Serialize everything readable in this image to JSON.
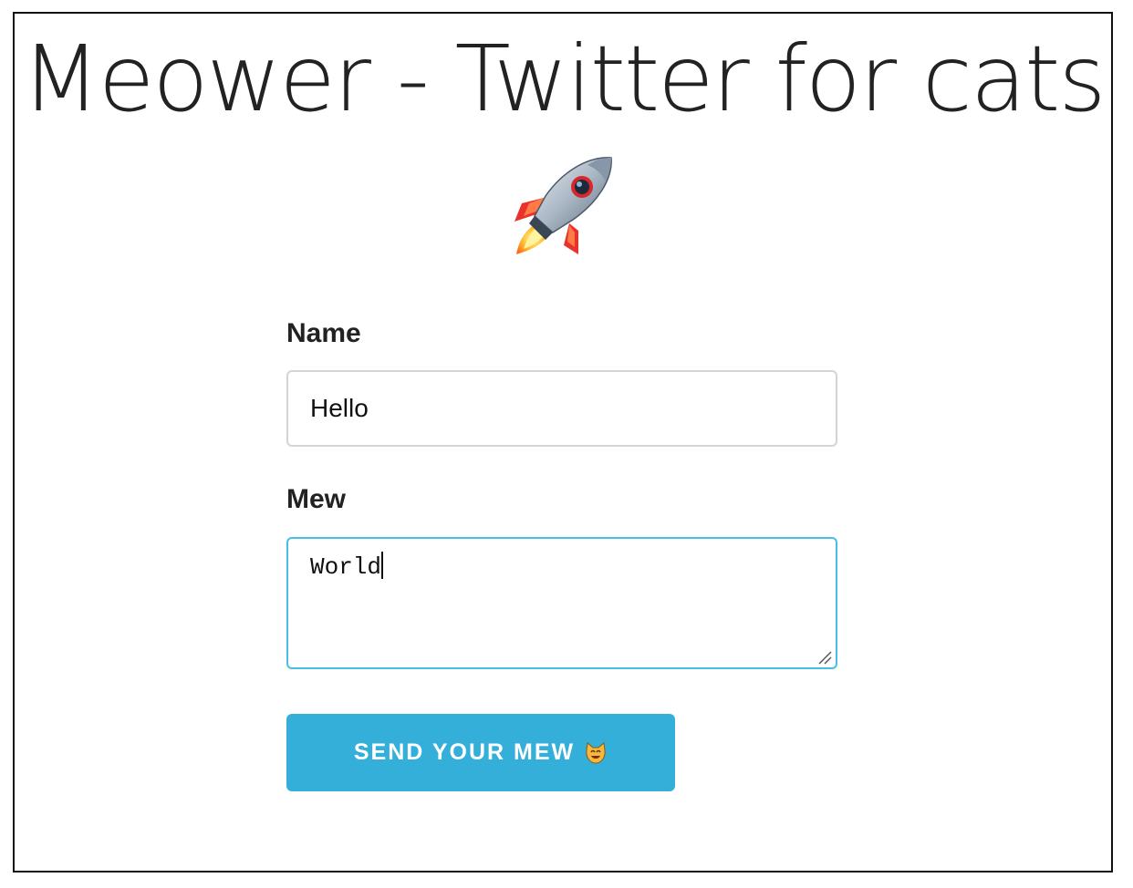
{
  "page": {
    "title": "Meower - Twitter for cats",
    "hero_icon": "rocket-icon"
  },
  "form": {
    "name_label": "Name",
    "name_value": "Hello",
    "mew_label": "Mew",
    "mew_value": "World",
    "submit_label": "SEND YOUR MEW",
    "submit_icon": "smiling-cat-icon"
  },
  "colors": {
    "button_background": "#34afd9",
    "focused_border": "#49bde6",
    "input_border": "#d4d4d4"
  }
}
